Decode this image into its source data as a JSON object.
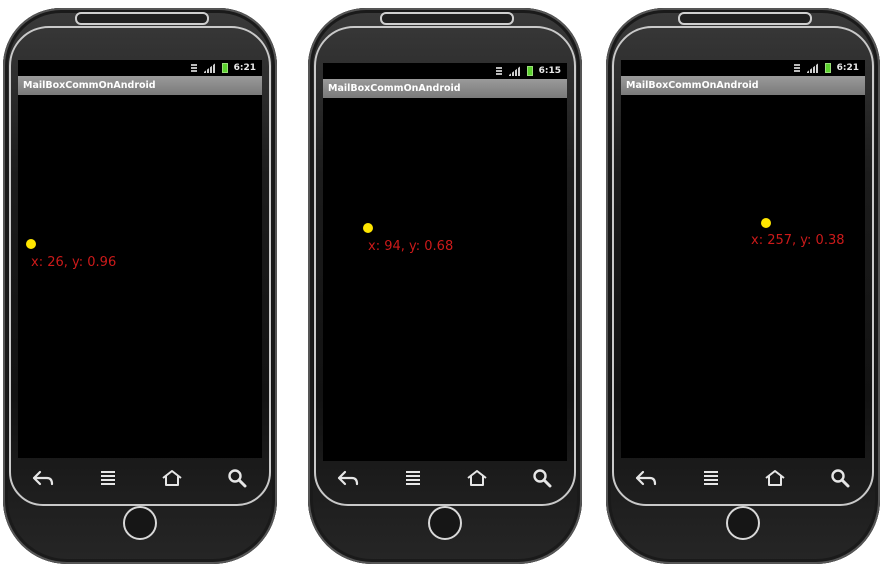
{
  "phones": [
    {
      "status": {
        "time": "6:21"
      },
      "app_title": "MailBoxCommOnAndroid",
      "touch": {
        "label": "x: 26, y: 0.96"
      }
    },
    {
      "status": {
        "time": "6:15"
      },
      "app_title": "MailBoxCommOnAndroid",
      "touch": {
        "label": "x: 94, y: 0.68"
      }
    },
    {
      "status": {
        "time": "6:21"
      },
      "app_title": "MailBoxCommOnAndroid",
      "touch": {
        "label": "x: 257, y: 0.38"
      }
    }
  ],
  "nav_icons": [
    "back-icon",
    "menu-icon",
    "home-icon",
    "search-icon"
  ],
  "colors": {
    "touch_dot": "#ffe600",
    "coord_text": "#cc1a1a",
    "titlebar": "#8a8a8a",
    "screen": "#000000"
  }
}
